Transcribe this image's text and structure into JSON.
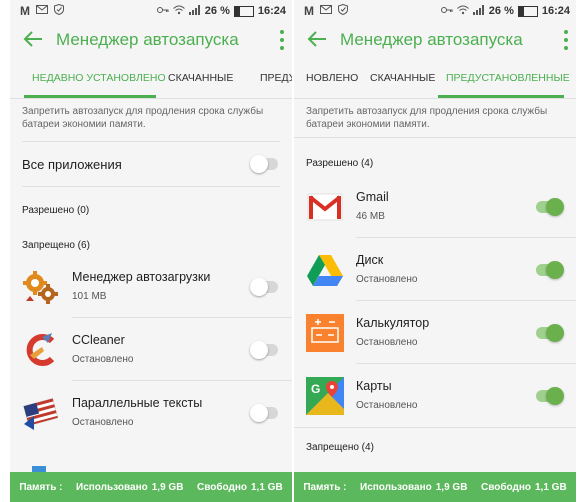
{
  "status": {
    "percent": "26 %",
    "time": "16:24"
  },
  "left": {
    "title": "Менеджер автозапуска",
    "tabs": [
      "НЕДАВНО УСТАНОВЛЕНО",
      "СКАЧАННЫЕ",
      "ПРЕДУ"
    ],
    "description": "Запретить автозапуск для продления срока службы батареи экономии памяти.",
    "all_apps": "Все приложения",
    "allowed_header": "Разрешено (0)",
    "denied_header": "Запрещено (6)",
    "apps": [
      {
        "name": "Менеджер автозагрузки",
        "sub": "101 MB",
        "icon": "gears-icon"
      },
      {
        "name": "CCleaner",
        "sub": "Остановлено",
        "icon": "ccleaner-icon"
      },
      {
        "name": "Параллельные тексты",
        "sub": "Остановлено",
        "icon": "flags-icon"
      }
    ],
    "footer": {
      "memory": "Память :",
      "used_label": "Использовано",
      "used": "1,9 GB",
      "free_label": "Свободно",
      "free": "1,1 GB"
    }
  },
  "right": {
    "title": "Менеджер автозапуска",
    "tabs": [
      "НОВЛЕНО",
      "СКАЧАННЫЕ",
      "ПРЕДУСТАНОВЛЕННЫЕ"
    ],
    "description": "Запретить автозапуск для продления срока службы батареи экономии памяти.",
    "allowed_header": "Разрешено (4)",
    "denied_header": "Запрещено (4)",
    "apps": [
      {
        "name": "Gmail",
        "sub": "46 MB",
        "icon": "gmail-icon"
      },
      {
        "name": "Диск",
        "sub": "Остановлено",
        "icon": "drive-icon"
      },
      {
        "name": "Калькулятор",
        "sub": "Остановлено",
        "icon": "calculator-icon"
      },
      {
        "name": "Карты",
        "sub": "Остановлено",
        "icon": "maps-icon"
      }
    ],
    "footer": {
      "memory": "Память :",
      "used_label": "Использовано",
      "used": "1,9 GB",
      "free_label": "Свободно",
      "free": "1,1 GB"
    }
  },
  "colors": {
    "accent": "#4caf50",
    "footer": "#5cb85c",
    "toggle_on": "#6ab04c"
  }
}
